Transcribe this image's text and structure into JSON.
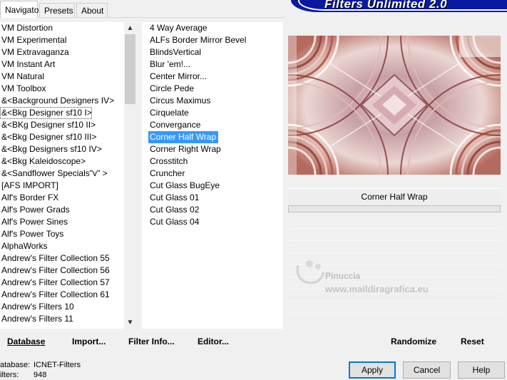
{
  "tabs": [
    {
      "label": "Navigator",
      "active": true
    },
    {
      "label": "Presets",
      "active": false
    },
    {
      "label": "About",
      "active": false
    }
  ],
  "banner": {
    "title": "Filters Unlimited 2.0",
    "color": "#0a1aa0"
  },
  "categories": [
    "VM Distortion",
    "VM Experimental",
    "VM Extravaganza",
    "VM Instant Art",
    "VM Natural",
    "VM Toolbox",
    "&<Background Designers IV>",
    "&<Bkg Designer sf10 I>",
    "&<BKg Designer sf10 II>",
    "&<Bkg Designer sf10 III>",
    "&<Bkg Designers sf10 IV>",
    "&<Bkg Kaleidoscope>",
    "&<Sandflower Specials\"v\" >",
    "[AFS IMPORT]",
    "Alf's Border FX",
    "Alf's Power Grads",
    "Alf's Power Sines",
    "Alf's Power Toys",
    "AlphaWorks",
    "Andrew's Filter Collection 55",
    "Andrew's Filter Collection 56",
    "Andrew's Filter Collection 57",
    "Andrew's Filter Collection 61",
    "Andrew's Filters 10",
    "Andrew's Filters 11"
  ],
  "selected_category": "&<Bkg Designer sf10 I>",
  "filters": [
    "4 Way Average",
    "ALFs Border Mirror Bevel",
    "BlindsVertical",
    "Blur 'em!...",
    "Center Mirror...",
    "Circle Pede",
    "Circus Maximus",
    "Cirquelate",
    "Convergance",
    "Corner Half Wrap",
    "Corner Right Wrap",
    "Crosstitch",
    "Cruncher",
    "Cut Glass  BugEye",
    "Cut Glass 01",
    "Cut Glass 02",
    "Cut Glass 04"
  ],
  "selected_filter": "Corner Half Wrap",
  "preview": {
    "filter_name": "Corner Half Wrap",
    "progress": 0
  },
  "watermark": {
    "line1": "Pinuccia",
    "line2": "www.maildiragrafica.eu"
  },
  "bottom": {
    "database": "Database",
    "import": "Import...",
    "filter_info": "Filter Info...",
    "editor": "Editor...",
    "randomize": "Randomize",
    "reset": "Reset"
  },
  "info": {
    "database_label": "atabase:",
    "database_value": "ICNET-Filters",
    "filters_label": "ilters:",
    "filters_value": "948"
  },
  "buttons": {
    "apply": "Apply",
    "cancel": "Cancel",
    "help": "Help"
  },
  "colors": {
    "selection": "#3399ff",
    "dialog_bg": "#f0f0f0"
  }
}
